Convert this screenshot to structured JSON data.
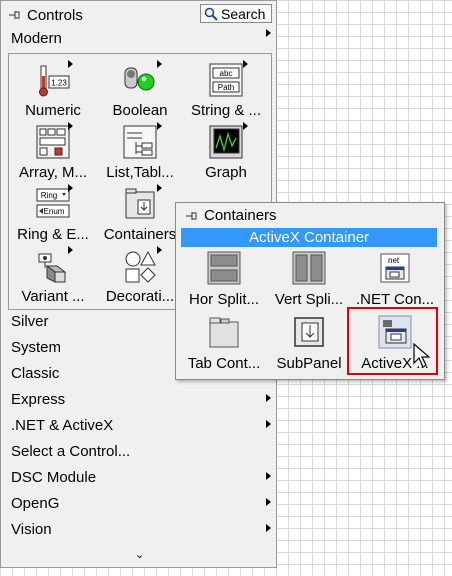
{
  "palette": {
    "title": "Controls",
    "search_label": "Search",
    "categories_top": [
      {
        "label": "Modern"
      }
    ],
    "modern_items": [
      {
        "label": "Numeric",
        "icon": "numeric-icon"
      },
      {
        "label": "Boolean",
        "icon": "boolean-icon"
      },
      {
        "label": "String & ...",
        "icon": "string-path-icon"
      },
      {
        "label": "Array, M...",
        "icon": "array-icon"
      },
      {
        "label": "List,Tabl...",
        "icon": "list-table-icon"
      },
      {
        "label": "Graph",
        "icon": "graph-icon"
      },
      {
        "label": "Ring & E...",
        "icon": "ring-enum-icon"
      },
      {
        "label": "Containers",
        "icon": "containers-icon"
      },
      {
        "label": "Variant ...",
        "icon": "variant-icon"
      },
      {
        "label": "Decorati...",
        "icon": "decorations-icon"
      }
    ],
    "categories": [
      {
        "label": "Silver",
        "submenu": false
      },
      {
        "label": "System",
        "submenu": false
      },
      {
        "label": "Classic",
        "submenu": false
      },
      {
        "label": "Express",
        "submenu": true
      },
      {
        "label": ".NET & ActiveX",
        "submenu": true
      },
      {
        "label": "Select a Control...",
        "submenu": false
      },
      {
        "label": "DSC Module",
        "submenu": true
      },
      {
        "label": "OpenG",
        "submenu": true
      },
      {
        "label": "Vision",
        "submenu": true
      }
    ],
    "expand_glyph": "⌄"
  },
  "containers_popup": {
    "title": "Containers",
    "tooltip": "ActiveX Container",
    "items": [
      {
        "label": "Hor Split...",
        "icon": "horizontal-splitter-icon"
      },
      {
        "label": "Vert Spli...",
        "icon": "vertical-splitter-icon"
      },
      {
        "label": ".NET Con...",
        "icon": "dotnet-container-icon",
        "badge": "net"
      },
      {
        "label": "Tab Cont...",
        "icon": "tab-control-icon"
      },
      {
        "label": "SubPanel",
        "icon": "subpanel-icon"
      },
      {
        "label": "ActiveX ...",
        "icon": "activex-container-icon"
      }
    ]
  },
  "icon_text": {
    "numeric": "1.23",
    "string_top": "abc",
    "string_bottom": "Path",
    "ring": "Ring",
    "enum": "Enum"
  },
  "colors": {
    "selection": "#3399ff",
    "highlight_box": "#e00000",
    "boolean_led": "#22cc22"
  }
}
